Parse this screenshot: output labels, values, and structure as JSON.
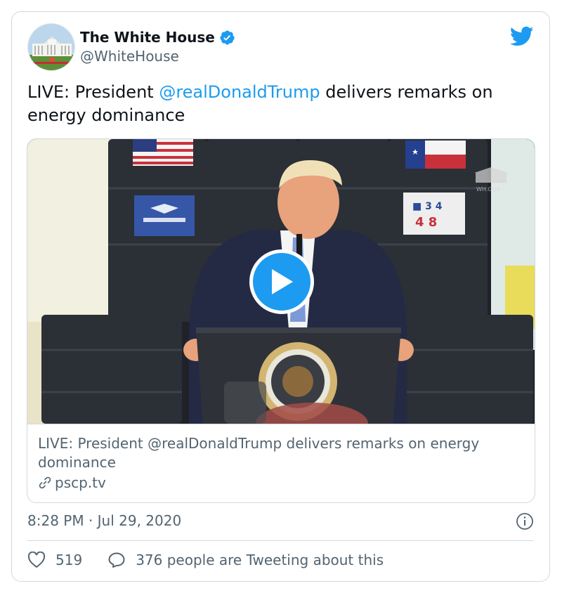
{
  "tweet": {
    "author_name": "The White House",
    "author_handle": "@WhiteHouse",
    "text_before": "LIVE: President ",
    "mention": "@realDonaldTrump",
    "text_after": " delivers remarks on energy dominance",
    "timestamp": "8:28 PM · Jul 29, 2020"
  },
  "media_card": {
    "title": "LIVE: President @realDonaldTrump delivers remarks on energy dominance",
    "domain": "pscp.tv",
    "watermark": "WH.GOV"
  },
  "actions": {
    "likes": "519",
    "conversation": "376 people are Tweeting about this"
  },
  "icons": {
    "verified": "verified-badge-icon",
    "bird": "twitter-bird-icon",
    "play": "play-icon",
    "link": "link-icon",
    "info": "info-icon",
    "heart": "heart-icon",
    "reply": "speech-bubble-icon"
  },
  "colors": {
    "accent": "#1d9bf0",
    "text": "#0f1419",
    "muted": "#536471",
    "border": "#cfd9de"
  }
}
